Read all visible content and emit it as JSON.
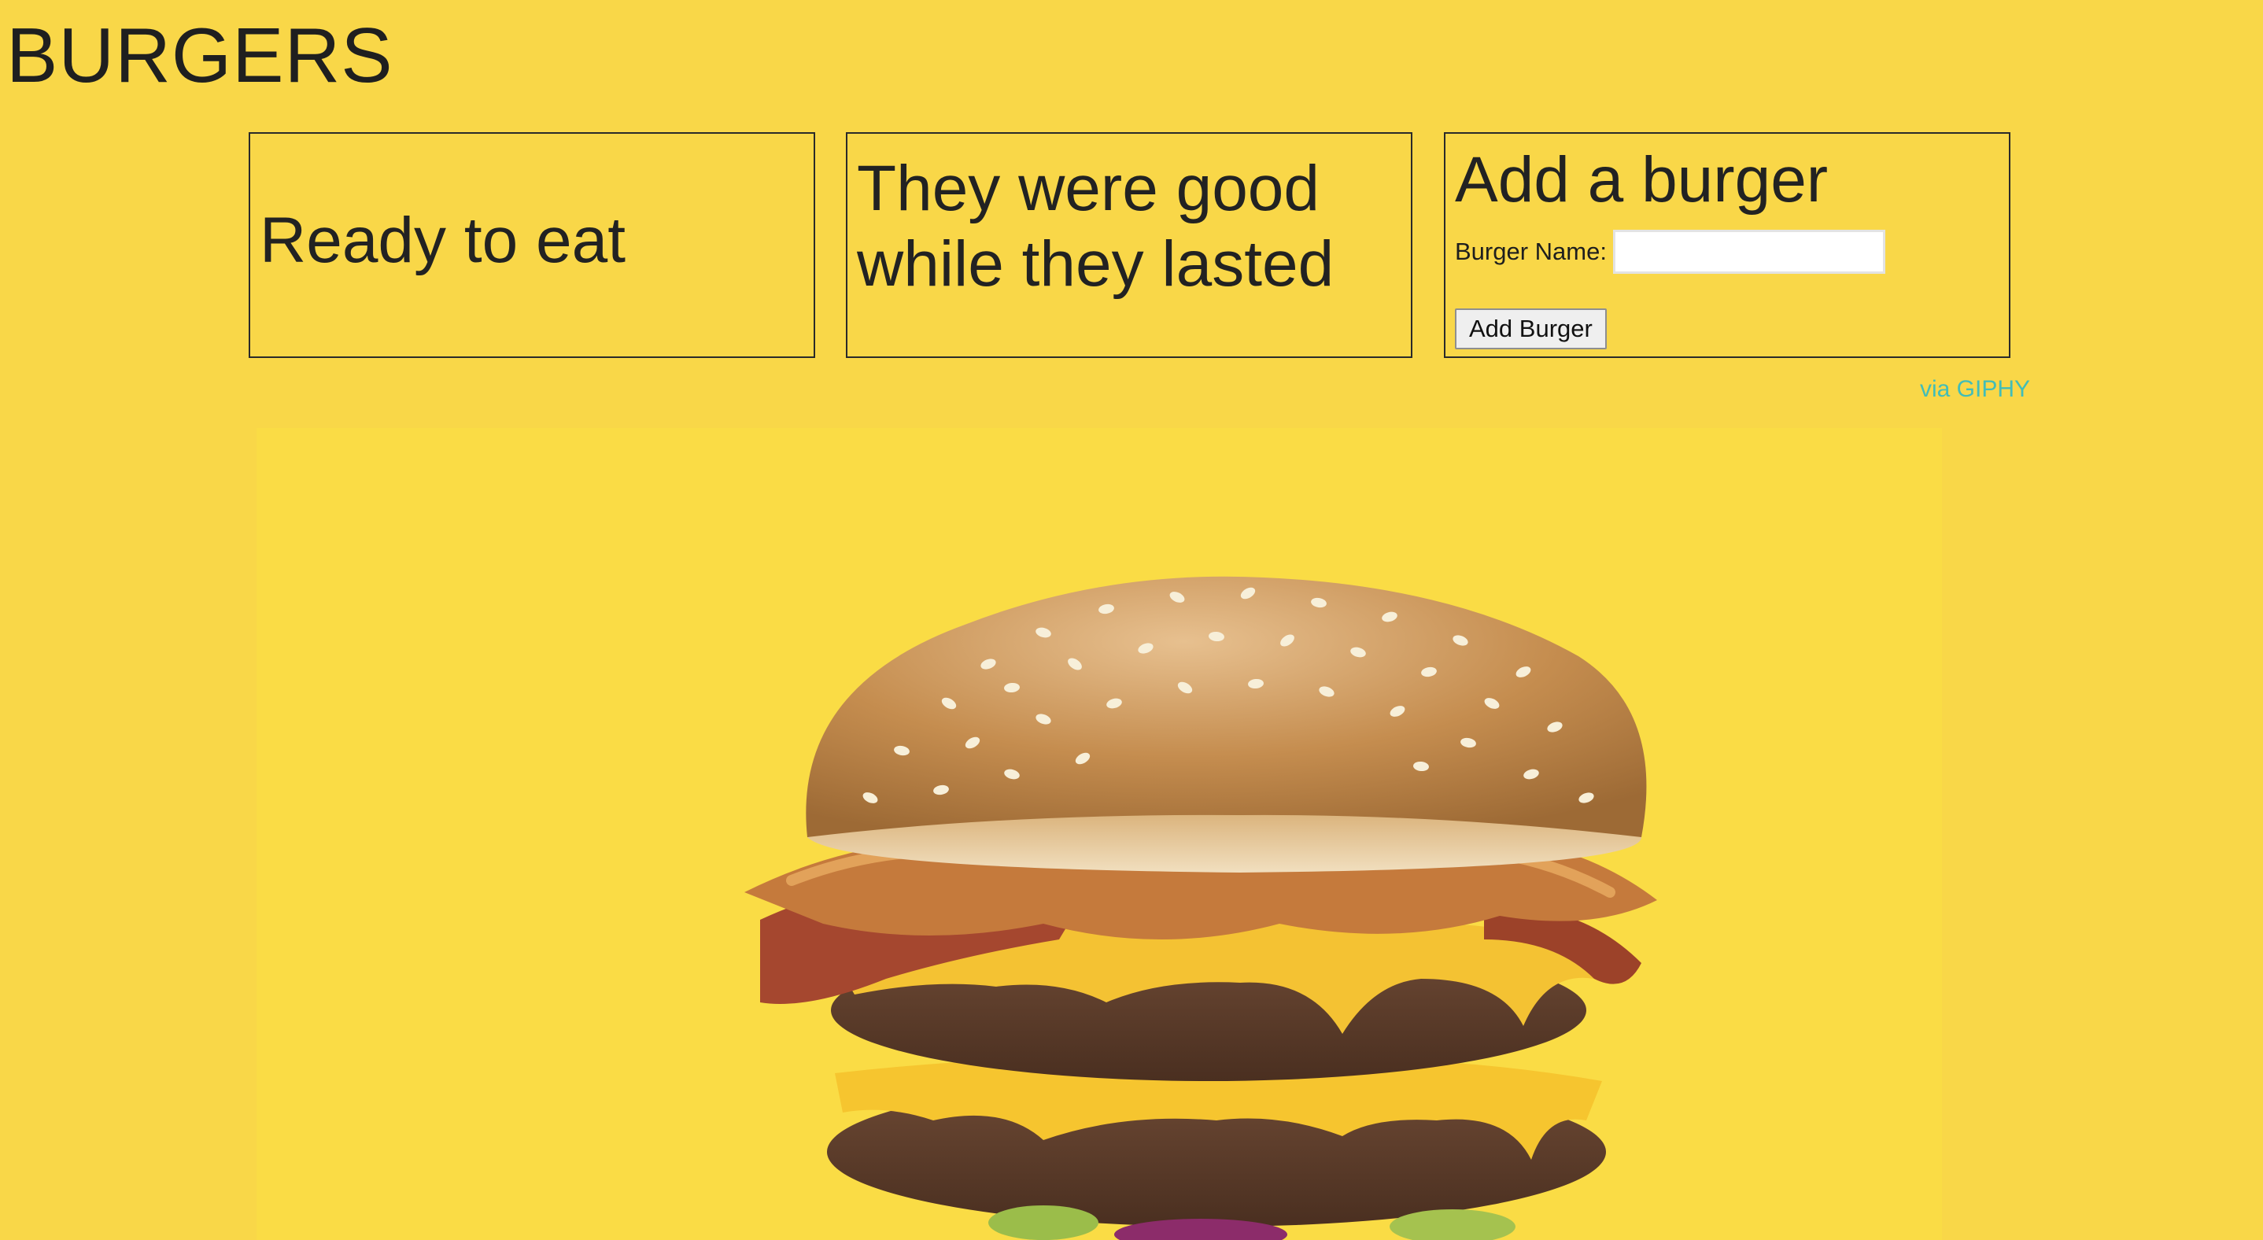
{
  "page": {
    "title": "BURGERS"
  },
  "columns": {
    "ready": {
      "heading": "Ready to eat"
    },
    "devoured": {
      "heading": "They were good while they lasted"
    }
  },
  "add_form": {
    "heading": "Add a burger",
    "name_label": "Burger Name:",
    "name_value": "",
    "submit_label": "Add Burger"
  },
  "attribution": {
    "link_text": "via GIPHY"
  },
  "gif": {
    "subject": "burger-image"
  },
  "colors": {
    "background": "#f9d748",
    "gif_background": "#fadc45",
    "text": "#222222",
    "link": "#42bdb8",
    "border": "#2a2a2a"
  }
}
